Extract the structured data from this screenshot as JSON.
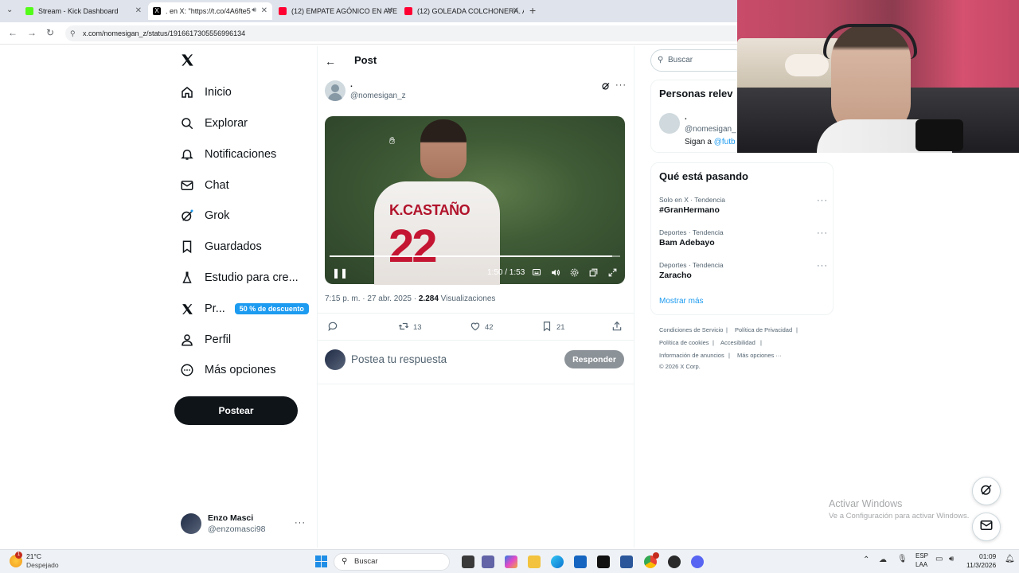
{
  "browser": {
    "tabs": [
      {
        "title": "Stream - Kick Dashboard",
        "favicon_color": "#53fc18",
        "active": false
      },
      {
        "title": ". en X: \"https://t.co/4A6fte5",
        "favicon_color": "#000000",
        "active": true
      },
      {
        "title": "(12) EMPATE AGÓNICO EN AVE",
        "favicon_color": "#ff0033",
        "active": false
      },
      {
        "title": "(12) GOLEADA COLCHONERA. A",
        "favicon_color": "#ff0033",
        "active": false
      }
    ],
    "url": "x.com/nomesigan_z/status/1916617305556996134"
  },
  "nav": {
    "items": [
      {
        "label": "Inicio",
        "icon": "home-icon"
      },
      {
        "label": "Explorar",
        "icon": "search-icon"
      },
      {
        "label": "Notificaciones",
        "icon": "bell-icon"
      },
      {
        "label": "Chat",
        "icon": "envelope-icon"
      },
      {
        "label": "Grok",
        "icon": "grok-icon"
      },
      {
        "label": "Guardados",
        "icon": "bookmark-icon"
      },
      {
        "label": "Estudio para cre...",
        "icon": "flask-icon"
      },
      {
        "label": "Pr...",
        "icon": "x-premium-icon"
      },
      {
        "label": "Perfil",
        "icon": "person-icon"
      },
      {
        "label": "Más opciones",
        "icon": "more-circle-icon"
      }
    ],
    "premium_badge": "50 % de descuento",
    "post_button": "Postear",
    "account": {
      "name": "Enzo Masci",
      "handle": "@enzomasci98"
    }
  },
  "post": {
    "header_title": "Post",
    "author_name": ".",
    "author_handle": "@nomesigan_z",
    "video": {
      "shirt_name": "K.CASTAÑO",
      "shirt_number": "22",
      "time": "1:50 / 1:53",
      "progress": 0.973
    },
    "timestamp": "7:15 p. m. · 27 abr. 2025 · ",
    "views_count": "2.284",
    "views_label": " Visualizaciones",
    "stats": {
      "retweets": "13",
      "likes": "42",
      "bookmarks": "21"
    },
    "reply_placeholder": "Postea tu respuesta",
    "reply_button": "Responder"
  },
  "right": {
    "search_placeholder": "Buscar",
    "relevant_title": "Personas relev",
    "relevant_person": {
      "name": ".",
      "handle": "@nomesigan_",
      "bio_prefix": "Sigan a ",
      "bio_link": "@futb"
    },
    "trending_title": "Qué está pasando",
    "trends": [
      {
        "meta": "Solo en X · Tendencia",
        "name": "#GranHermano"
      },
      {
        "meta": "Deportes · Tendencia",
        "name": "Bam Adebayo"
      },
      {
        "meta": "Deportes · Tendencia",
        "name": "Zaracho"
      }
    ],
    "show_more": "Mostrar más",
    "footer": {
      "terms": "Condiciones de Servicio",
      "privacy": "Política de Privacidad",
      "cookies": "Política de cookies",
      "accessibility": "Accesibilidad",
      "ads": "Información de anuncios",
      "more": "Más opciones ···",
      "copyright": "© 2026 X Corp."
    }
  },
  "windows": {
    "activate_title": "Activar Windows",
    "activate_sub": "Ve a Configuración para activar Windows.",
    "weather_temp": "21°C",
    "weather_desc": "Despejado",
    "search": "Buscar",
    "lang_top": "ESP",
    "lang_bottom": "LAA",
    "time": "01:09",
    "date": "11/3/2026"
  }
}
